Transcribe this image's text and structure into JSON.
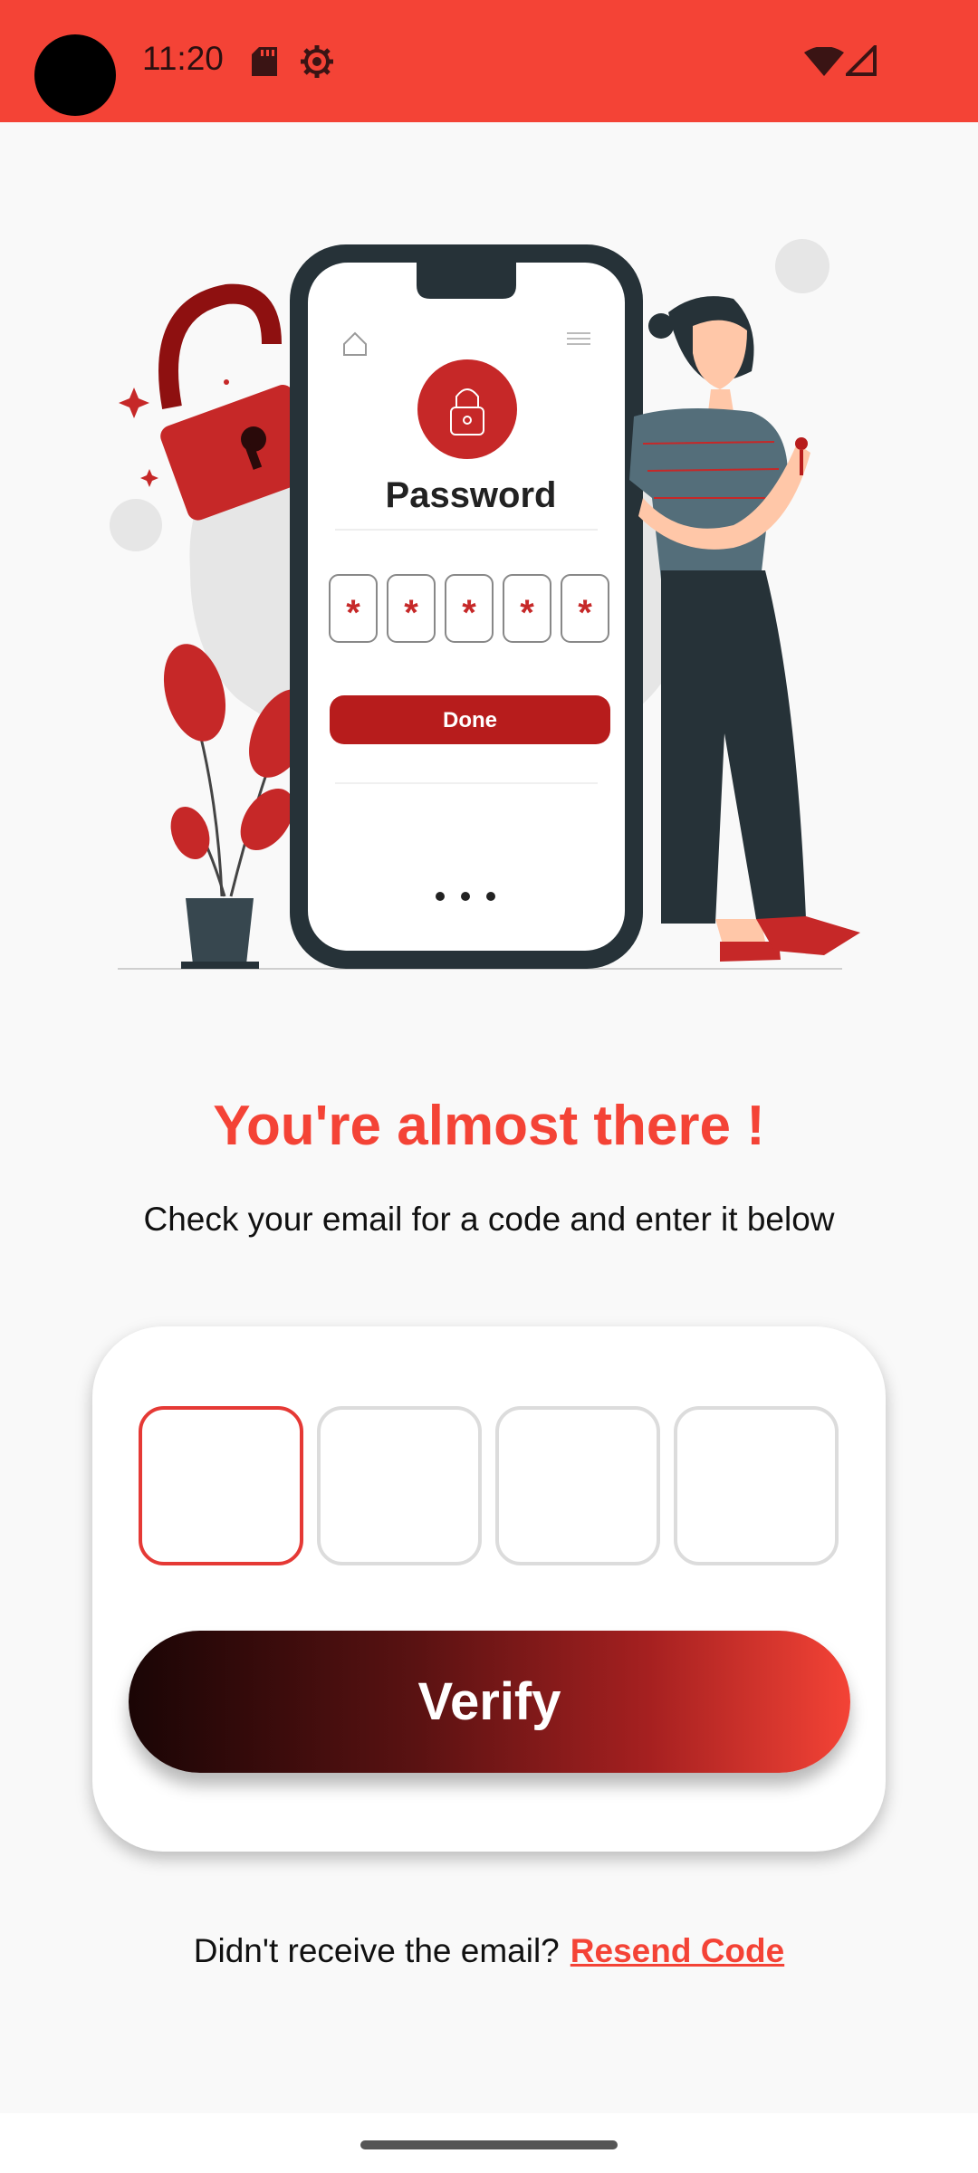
{
  "status_bar": {
    "time": "11:20",
    "icons": [
      "sd-card-icon",
      "gear-icon",
      "wifi-icon",
      "signal-icon"
    ],
    "color": "#f44336"
  },
  "illustration": {
    "screen_title": "Password",
    "pin_mask": [
      "*",
      "*",
      "*",
      "*",
      "*"
    ],
    "done_label": "Done"
  },
  "main": {
    "headline": "You're almost there !",
    "subtitle": "Check your email for a code and enter it below"
  },
  "code_inputs": [
    "",
    "",
    "",
    ""
  ],
  "verify_label": "Verify",
  "resend": {
    "prompt": "Didn't receive the email?",
    "link": "Resend Code"
  },
  "colors": {
    "accent": "#f44336",
    "illustration_red": "#c62828",
    "dark": "#263238"
  }
}
